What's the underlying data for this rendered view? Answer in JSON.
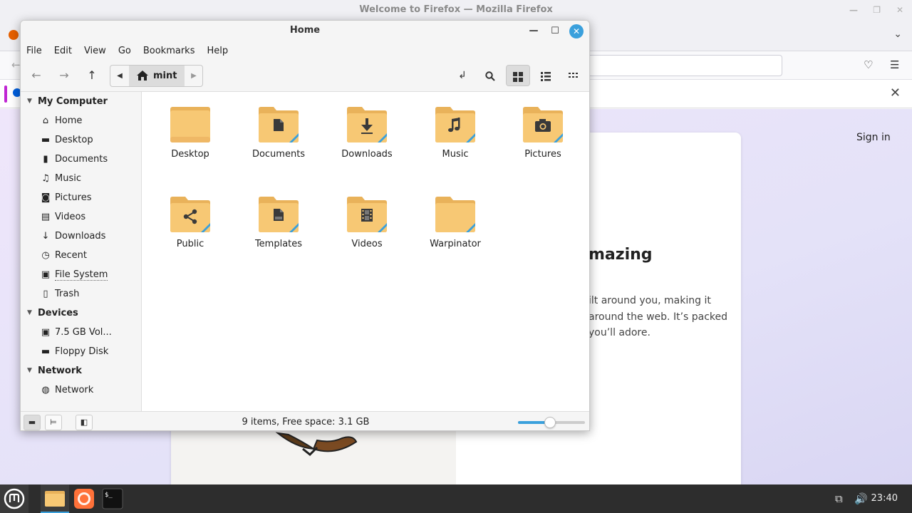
{
  "firefox": {
    "window_title": "Welcome to Firefox — Mozilla Firefox",
    "sign_in": "Sign in",
    "heading": "mazing",
    "paragraph_lines": [
      "ilt around you, making it",
      "around the web. It’s packed",
      "you’ll adore."
    ]
  },
  "nemo": {
    "window_title": "Home",
    "menu": [
      "File",
      "Edit",
      "View",
      "Go",
      "Bookmarks",
      "Help"
    ],
    "path": "mint",
    "toolbar_icons": [
      "back-icon",
      "forward-icon",
      "up-icon",
      "toggle-location-icon",
      "search-icon",
      "icon-view-icon",
      "list-view-icon",
      "compact-view-icon"
    ],
    "active_view": "icon-view",
    "sidebar": {
      "my_computer": {
        "title": "My Computer",
        "items": [
          {
            "label": "Home",
            "icon": "home-icon"
          },
          {
            "label": "Desktop",
            "icon": "desktop-icon"
          },
          {
            "label": "Documents",
            "icon": "documents-icon"
          },
          {
            "label": "Music",
            "icon": "music-icon"
          },
          {
            "label": "Pictures",
            "icon": "pictures-icon"
          },
          {
            "label": "Videos",
            "icon": "videos-icon"
          },
          {
            "label": "Downloads",
            "icon": "downloads-icon"
          },
          {
            "label": "Recent",
            "icon": "recent-icon"
          },
          {
            "label": "File System",
            "icon": "drive-icon"
          },
          {
            "label": "Trash",
            "icon": "trash-icon"
          }
        ]
      },
      "devices": {
        "title": "Devices",
        "items": [
          {
            "label": "7.5 GB Vol...",
            "icon": "drive-icon"
          },
          {
            "label": "Floppy Disk",
            "icon": "floppy-icon"
          }
        ]
      },
      "network": {
        "title": "Network",
        "items": [
          {
            "label": "Network",
            "icon": "network-icon"
          }
        ]
      }
    },
    "files": [
      {
        "name": "Desktop",
        "emblem": "none"
      },
      {
        "name": "Documents",
        "emblem": "document"
      },
      {
        "name": "Downloads",
        "emblem": "download"
      },
      {
        "name": "Music",
        "emblem": "music"
      },
      {
        "name": "Pictures",
        "emblem": "camera"
      },
      {
        "name": "Public",
        "emblem": "share"
      },
      {
        "name": "Templates",
        "emblem": "template"
      },
      {
        "name": "Videos",
        "emblem": "film"
      },
      {
        "name": "Warpinator",
        "emblem": "none"
      }
    ],
    "status": "9 items, Free space: 3.1 GB",
    "zoom_fraction": 0.48
  },
  "taskbar": {
    "apps": [
      "menu-icon",
      "files-icon",
      "firefox-icon",
      "terminal-icon"
    ],
    "clock": "23:40"
  },
  "colors": {
    "accent": "#3aa0dc",
    "folder": "#f7c874",
    "folder_dark": "#e9b25a"
  }
}
